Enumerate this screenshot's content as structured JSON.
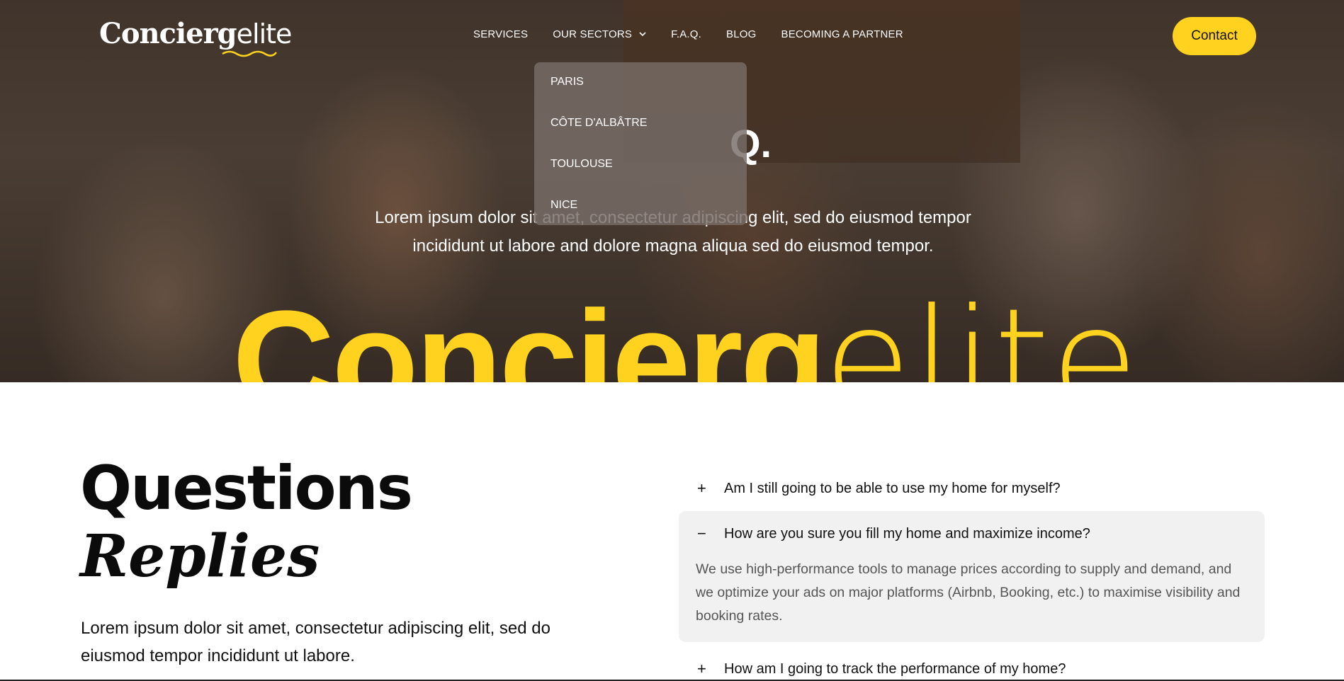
{
  "header": {
    "logo_bold": "Concierg",
    "logo_light": "elite",
    "nav": [
      "SERVICES",
      "OUR SECTORS",
      "F.A.Q.",
      "BLOG",
      "BECOMING A PARTNER"
    ],
    "contact_label": "Contact"
  },
  "dropdown": {
    "items": [
      "PARIS",
      "CÔTE D'ALBÂTRE",
      "TOULOUSE",
      "NICE"
    ]
  },
  "hero": {
    "heading_fragment": "Q.",
    "text": "Lorem ipsum dolor sit amet, consectetur adipiscing elit, sed do eiusmod tempor incididunt ut labore and dolore magna aliqua sed do eiusmod tempor.",
    "brand_bold": "Concierg",
    "brand_light": "elite"
  },
  "faq": {
    "title_line1": "Questions",
    "title_line2": "Replies",
    "intro": "Lorem ipsum dolor sit amet, consectetur adipiscing elit, sed do eiusmod tempor incididunt ut labore.",
    "items": [
      {
        "sign": "+",
        "question": "Am I still going to be able to use my home for myself?"
      },
      {
        "sign": "−",
        "question": "How are you sure you fill my home and maximize income?",
        "answer": "We use high-performance tools to manage prices according to supply and demand, and we optimize your ads on major platforms (Airbnb, Booking, etc.) to maximise visibility and booking rates."
      },
      {
        "sign": "+",
        "question": "How am I going to track the performance of my home?"
      }
    ]
  },
  "colors": {
    "accent": "#ffd21f",
    "text": "#111111",
    "panel": "#f1f1f1"
  }
}
